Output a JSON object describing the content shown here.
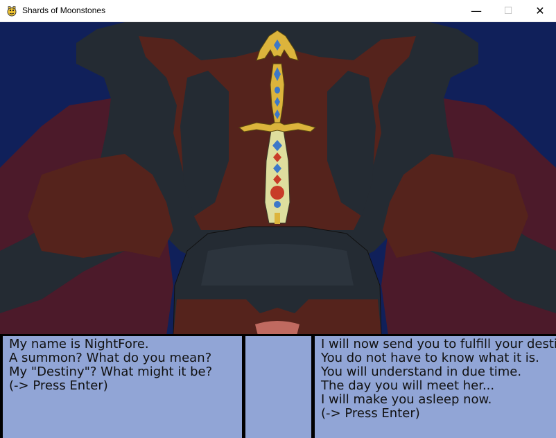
{
  "window": {
    "title": "Shards of Moonstones",
    "minimize_glyph": "—",
    "maximize_glyph": "☐",
    "close_glyph": "✕",
    "app_icon": "pygame-snake-icon"
  },
  "scene": {
    "description_icon": "sword-in-stone-icon",
    "colors": {
      "sky": "#10205a",
      "rock": "#242b33",
      "earth": "#55231c",
      "crimson": "#4c1a2a",
      "blade": "#dede9e",
      "gold": "#dcb43c",
      "gem_blue": "#3c78c8",
      "gem_red": "#c83c28"
    }
  },
  "dialog": {
    "left_box": {
      "lines": [
        "My name is NightFore.",
        "A summon? What do you mean?",
        "My \"Destiny\"? What might it be?",
        "(-> Press Enter)"
      ]
    },
    "middle_box": {
      "lines": []
    },
    "right_box": {
      "lines": [
        "I will now send you to fulfill your destiny.",
        "You do not have to know what it is.",
        "You will understand in due time.",
        "The day you will meet her...",
        "I will make you asleep now.",
        "(-> Press Enter)"
      ]
    },
    "box_color": "#91a5d6"
  }
}
